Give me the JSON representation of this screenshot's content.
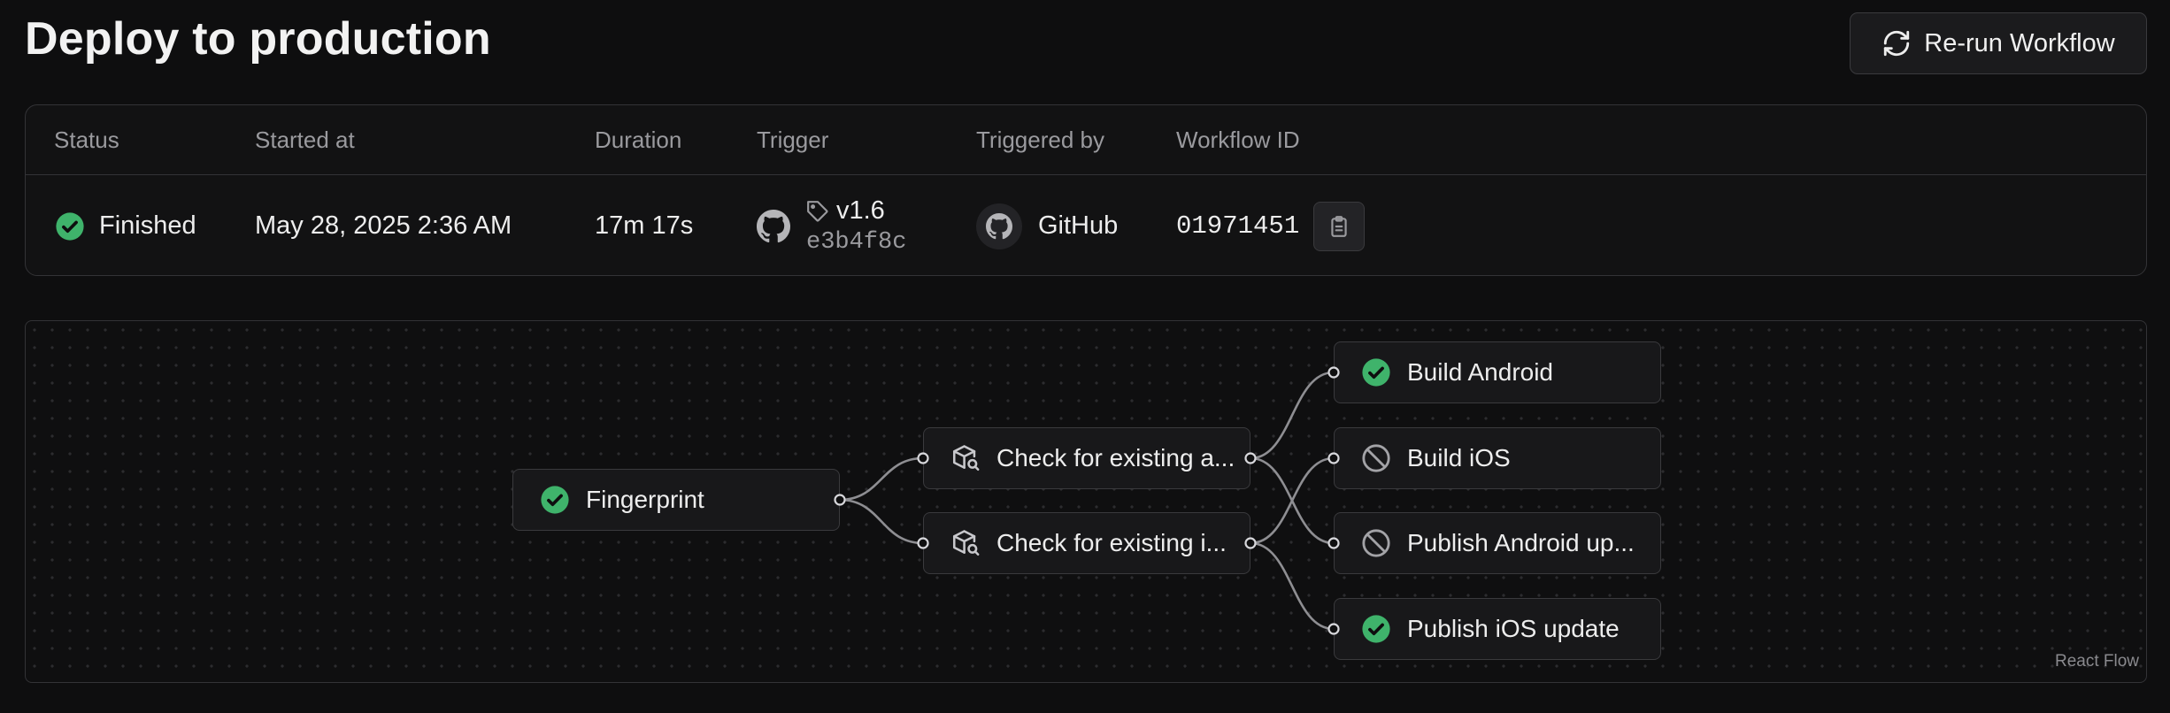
{
  "header": {
    "title": "Deploy to production",
    "rerun_label": "Re-run Workflow",
    "rerun_icon": "refresh-icon"
  },
  "info": {
    "columns": [
      "Status",
      "Started at",
      "Duration",
      "Trigger",
      "Triggered by",
      "Workflow ID"
    ],
    "status": "Finished",
    "status_color": "#3fb36b",
    "started_at": "May 28, 2025 2:36 AM",
    "duration": "17m 17s",
    "trigger_tag": "v1.6",
    "trigger_commit": "e3b4f8c",
    "trigger_icon": "github-icon",
    "triggered_by": "GitHub",
    "workflow_id": "01971451",
    "copy_icon": "clipboard-icon"
  },
  "flow": {
    "nodes": [
      {
        "id": "fingerprint",
        "label": "Fingerprint",
        "icon": "check-circle-icon",
        "status": "success"
      },
      {
        "id": "check-android",
        "label": "Check for existing a...",
        "icon": "package-search-icon",
        "status": "neutral"
      },
      {
        "id": "check-ios",
        "label": "Check for existing i...",
        "icon": "package-search-icon",
        "status": "neutral"
      },
      {
        "id": "build-android",
        "label": "Build Android",
        "icon": "check-circle-icon",
        "status": "success"
      },
      {
        "id": "build-ios",
        "label": "Build iOS",
        "icon": "skipped-icon",
        "status": "skipped"
      },
      {
        "id": "publish-android",
        "label": "Publish Android up...",
        "icon": "skipped-icon",
        "status": "skipped"
      },
      {
        "id": "publish-ios",
        "label": "Publish iOS update",
        "icon": "check-circle-icon",
        "status": "success"
      }
    ],
    "edges": [
      [
        "fingerprint",
        "check-android"
      ],
      [
        "fingerprint",
        "check-ios"
      ],
      [
        "check-android",
        "build-android"
      ],
      [
        "check-android",
        "publish-android"
      ],
      [
        "check-ios",
        "build-ios"
      ],
      [
        "check-ios",
        "publish-ios"
      ]
    ],
    "attribution": "React Flow"
  }
}
